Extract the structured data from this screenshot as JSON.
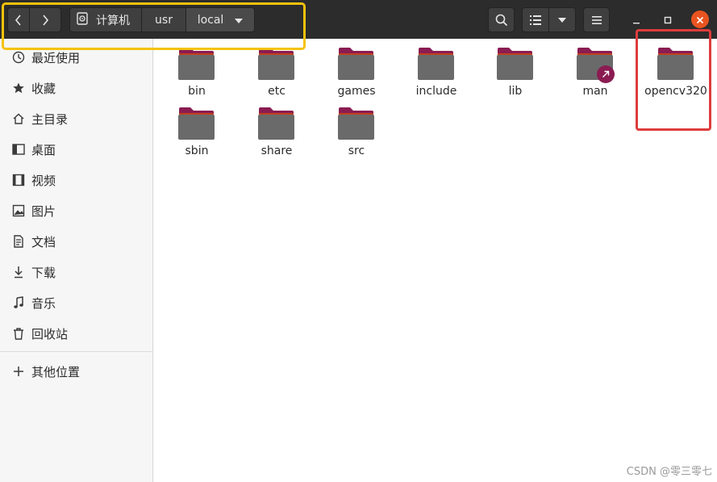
{
  "header": {
    "breadcrumb": [
      "计算机",
      "usr",
      "local"
    ],
    "nav_back_icon": "chevron-left-icon",
    "nav_forward_icon": "chevron-right-icon",
    "search_icon": "search-icon",
    "view_icon": "list-view-icon",
    "menu_icon": "hamburger-menu-icon"
  },
  "sidebar": {
    "items": [
      {
        "label": "最近使用",
        "icon": "clock-icon"
      },
      {
        "label": "收藏",
        "icon": "star-icon"
      },
      {
        "label": "主目录",
        "icon": "home-icon"
      },
      {
        "label": "桌面",
        "icon": "desktop-icon"
      },
      {
        "label": "视频",
        "icon": "video-icon"
      },
      {
        "label": "图片",
        "icon": "image-icon"
      },
      {
        "label": "文档",
        "icon": "document-icon"
      },
      {
        "label": "下载",
        "icon": "download-icon"
      },
      {
        "label": "音乐",
        "icon": "music-icon"
      },
      {
        "label": "回收站",
        "icon": "trash-icon"
      }
    ],
    "other_locations": "其他位置"
  },
  "files": [
    {
      "name": "bin"
    },
    {
      "name": "etc"
    },
    {
      "name": "games"
    },
    {
      "name": "include"
    },
    {
      "name": "lib"
    },
    {
      "name": "man",
      "symlink": true
    },
    {
      "name": "opencv320"
    },
    {
      "name": "sbin"
    },
    {
      "name": "share"
    },
    {
      "name": "src"
    }
  ],
  "watermark": "CSDN @零三零七",
  "colors": {
    "accent": "#e95420",
    "folder_tab": "#8a1c52",
    "folder_body": "#6a6a6a",
    "highlight_yellow": "#f5c20b",
    "highlight_red": "#de3c3c"
  }
}
